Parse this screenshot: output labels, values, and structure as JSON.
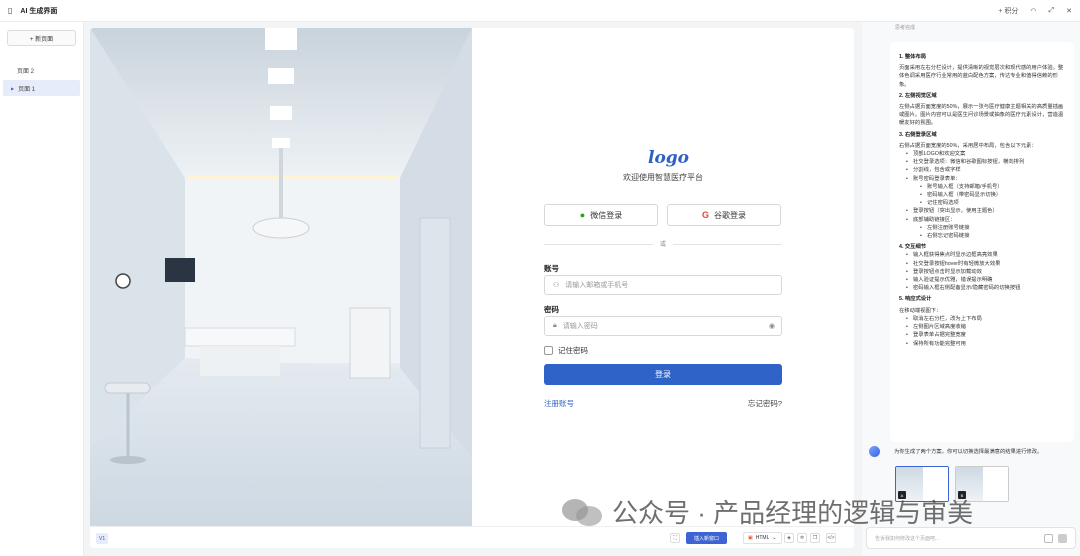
{
  "topbar": {
    "title": "AI 生成界面",
    "points": "积分"
  },
  "sidebar": {
    "new_page": "+ 新页面",
    "pages": [
      "页面 2",
      "页面 1"
    ]
  },
  "login": {
    "logo": "logo",
    "welcome": "欢迎使用智慧医疗平台",
    "wechat": "微信登录",
    "google": "谷歌登录",
    "or": "或",
    "account_label": "账号",
    "account_placeholder": "请输入邮箱或手机号",
    "password_label": "密码",
    "password_placeholder": "请输入密码",
    "remember": "记住密码",
    "submit": "登录",
    "register": "注册账号",
    "forgot": "忘记密码?"
  },
  "canvas_bar": {
    "version": "V1",
    "new_window": "插入新窗口",
    "format": "HTML"
  },
  "chat": {
    "header_hint": "思考完成",
    "sections": [
      {
        "title": "1. 整体布局",
        "text": "页面采用左右分栏设计，提供清晰的视觉层次和现代感的用户体验。整体色调采用医疗行业常用的蓝白配色方案，传达专业和值得信赖的形象。"
      },
      {
        "title": "2. 左侧视觉区域",
        "text": "左侧占据页面宽度的50%，展示一张与医疗健康主题相关的高质量插画或图片。图片内容可以是医生问诊场景或抽象的医疗元素设计，营造温暖友好的氛围。"
      },
      {
        "title": "3. 右侧登录区域",
        "text": "右侧占据页面宽度的50%，采用居中布局，包含以下元素："
      }
    ],
    "login_items": [
      "顶部LOGO和欢迎文案",
      "社交登录选项：微信和谷歌图标按钮，横向排列",
      "分割线，包含或字样",
      "账号密码登录表单："
    ],
    "form_items": [
      "账号输入框（支持邮箱/手机号）",
      "密码输入框（带密码显示切换）",
      "记住密码选项"
    ],
    "login_items2": [
      "登录按钮（突出显示，使用主题色）",
      "底部辅助链接区："
    ],
    "link_items": [
      "左侧注册账号链接",
      "右侧忘记密码链接"
    ],
    "sec4_title": "4. 交互细节",
    "interaction_items": [
      "输入框获得焦点时显示边框高亮效果",
      "社交登录按钮hover时有轻微放大效果",
      "登录按钮点击时显示加载动效",
      "输入验证提示优雅，错误提示明确",
      "密码输入框右侧配备显示/隐藏密码的切换按钮"
    ],
    "sec5_title": "5. 响应式设计",
    "sec5_text": "在移动端视图下：",
    "responsive_items": [
      "取消左右分栏，改为上下布局",
      "左侧图片区域高度收缩",
      "登录表单占据完整宽度",
      "保持所有功能完整可用"
    ],
    "bot_message": "为你生成了两个方案，你可以切换选择最满意的结果进行修改。",
    "thumbs": [
      "A",
      "B"
    ],
    "input_placeholder": "告诉我如何修改这个页面吧..."
  },
  "watermark": "公众号 · 产品经理的逻辑与审美"
}
